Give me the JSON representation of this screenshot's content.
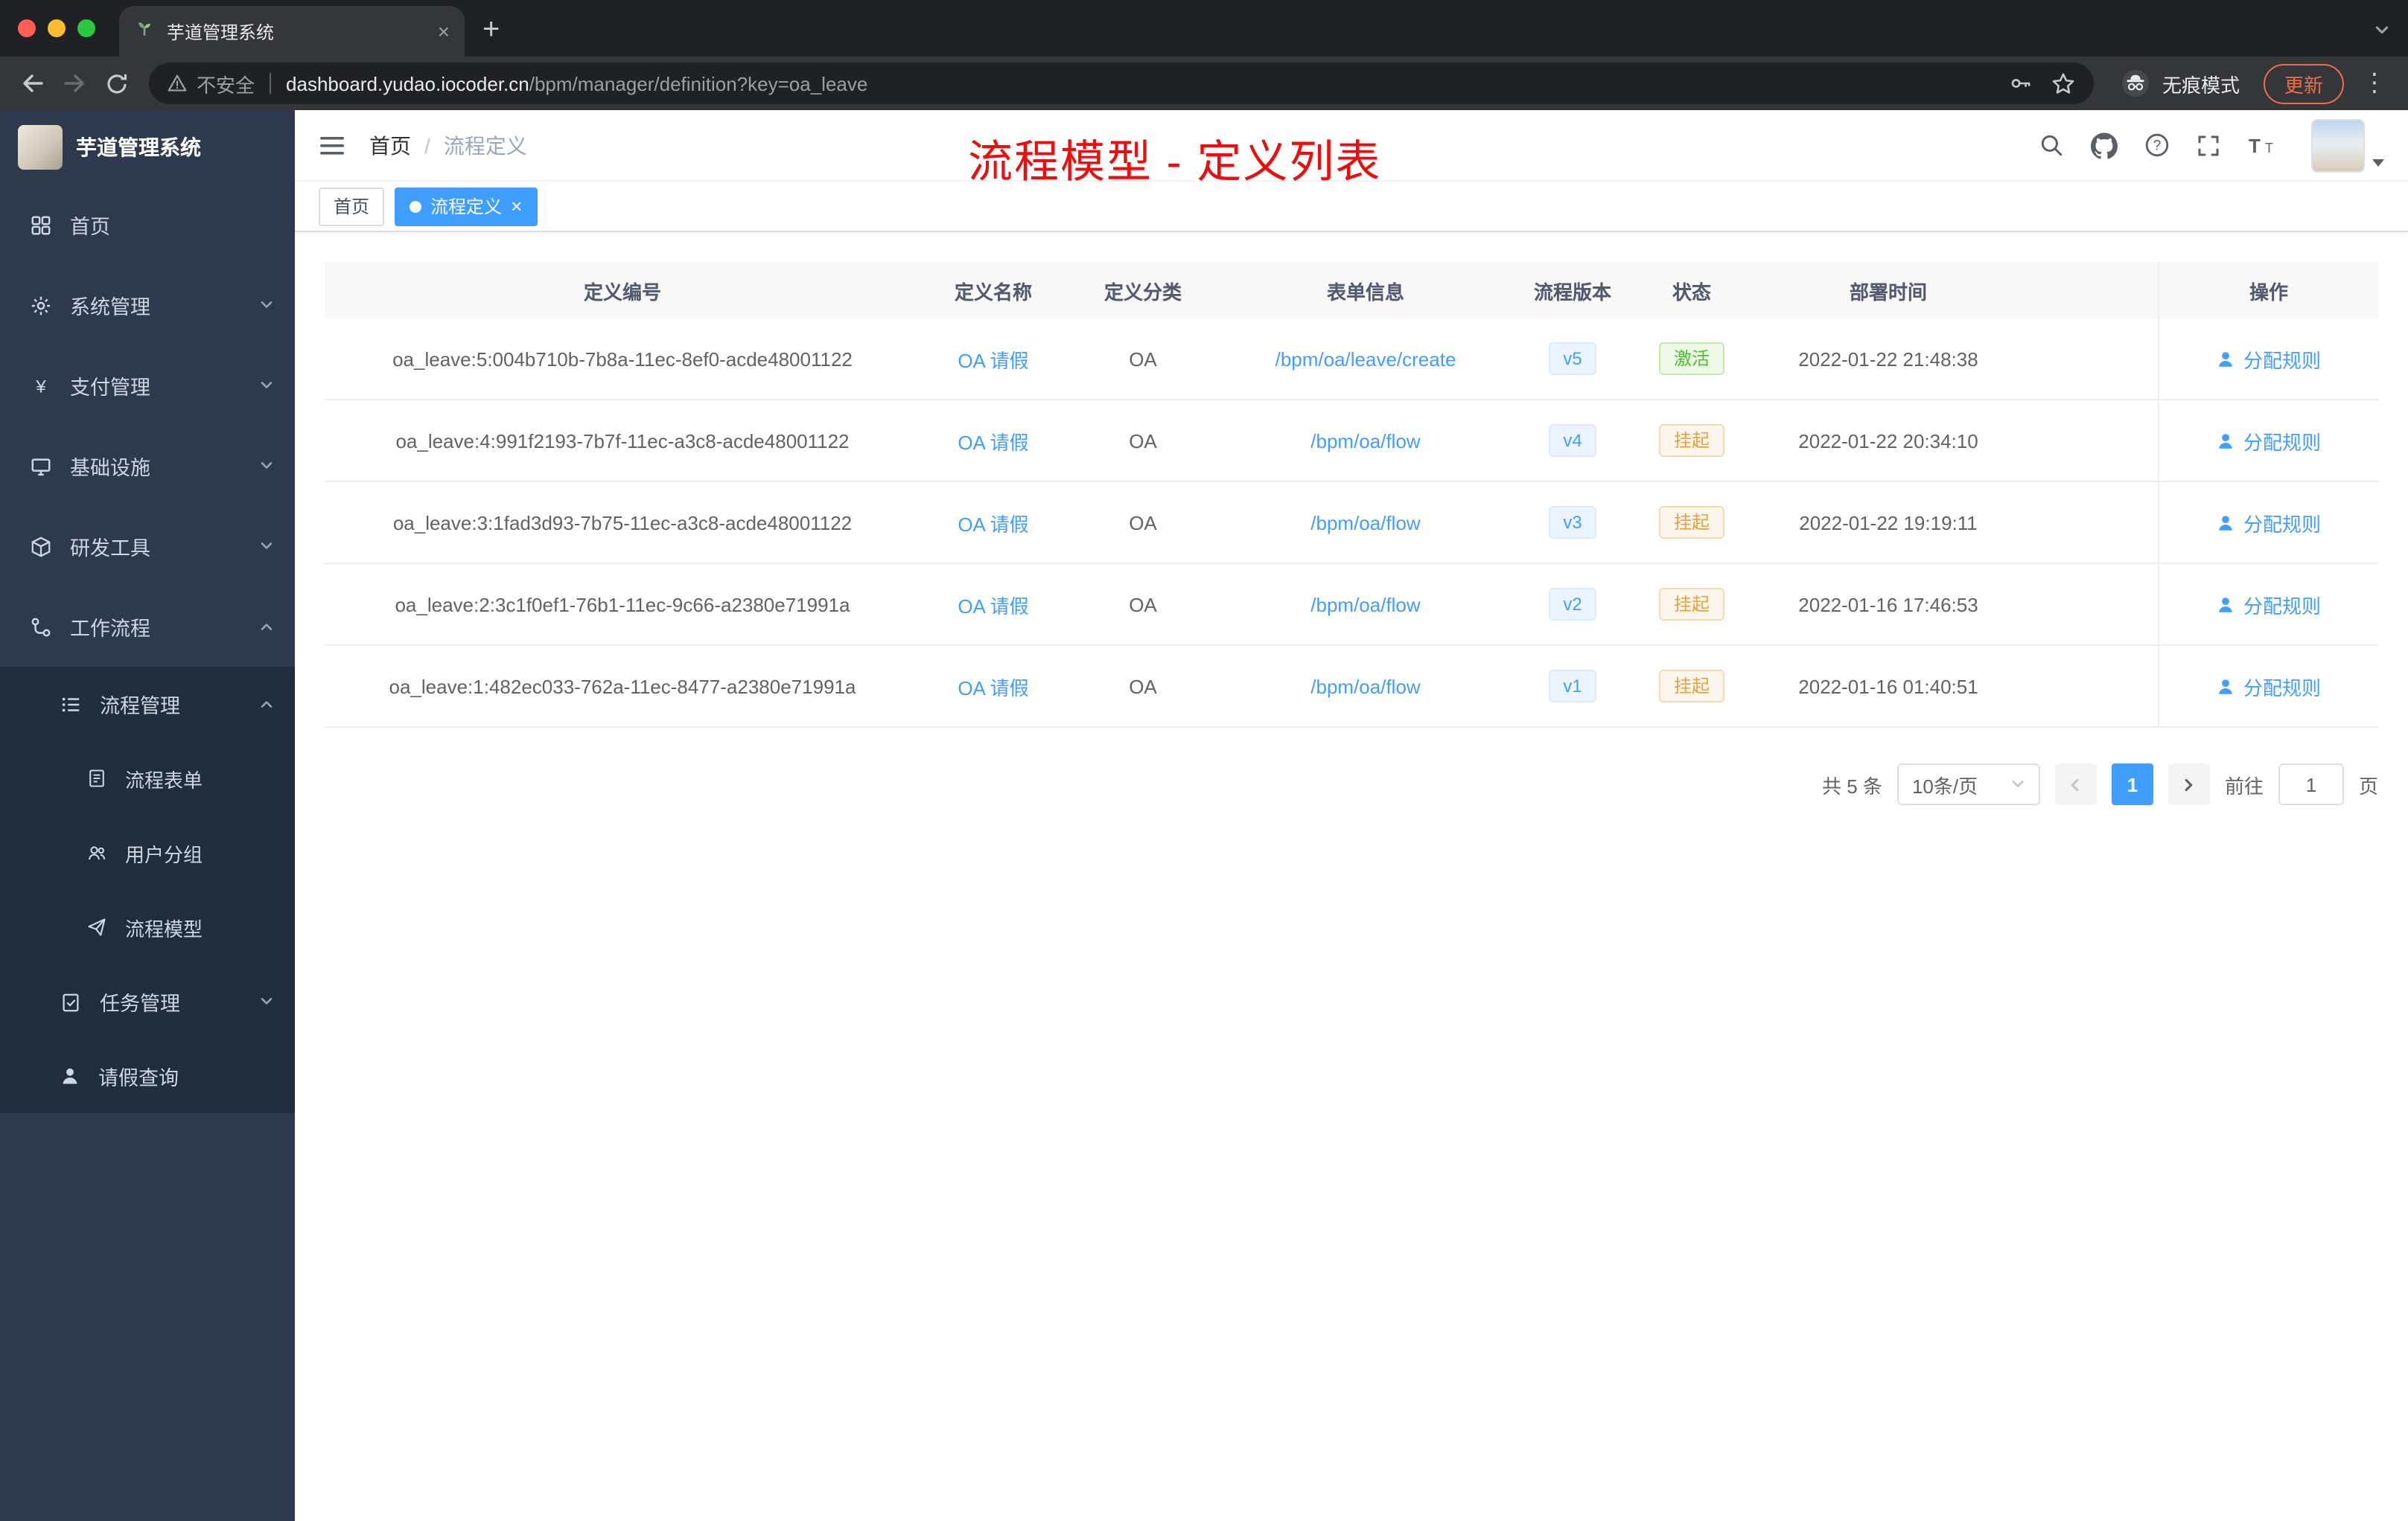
{
  "browser": {
    "tab_title": "芋道管理系统",
    "security_label": "不安全",
    "url_host": "dashboard.yudao.iocoder.cn",
    "url_path": "/bpm/manager/definition?key=oa_leave",
    "incognito_label": "无痕模式",
    "update_label": "更新"
  },
  "sidebar": {
    "logo_title": "芋道管理系统",
    "items": [
      {
        "label": "首页"
      },
      {
        "label": "系统管理"
      },
      {
        "label": "支付管理"
      },
      {
        "label": "基础设施"
      },
      {
        "label": "研发工具"
      },
      {
        "label": "工作流程"
      },
      {
        "label": "流程管理"
      },
      {
        "label": "流程表单"
      },
      {
        "label": "用户分组"
      },
      {
        "label": "流程模型"
      },
      {
        "label": "任务管理"
      },
      {
        "label": "请假查询"
      }
    ]
  },
  "header": {
    "breadcrumb_home": "首页",
    "breadcrumb_separator": "/",
    "breadcrumb_current": "流程定义",
    "annotation": "流程模型 - 定义列表"
  },
  "tags": {
    "home": "首页",
    "active": "流程定义"
  },
  "table": {
    "columns": [
      "定义编号",
      "定义名称",
      "定义分类",
      "表单信息",
      "流程版本",
      "状态",
      "部署时间",
      "操作"
    ],
    "rows": [
      {
        "id": "oa_leave:5:004b710b-7b8a-11ec-8ef0-acde48001122",
        "name": "OA 请假",
        "category": "OA",
        "form": "/bpm/oa/leave/create",
        "version": "v5",
        "status": "激活",
        "status_type": "success",
        "deploy_time": "2022-01-22 21:48:38",
        "action": "分配规则"
      },
      {
        "id": "oa_leave:4:991f2193-7b7f-11ec-a3c8-acde48001122",
        "name": "OA 请假",
        "category": "OA",
        "form": "/bpm/oa/flow",
        "version": "v4",
        "status": "挂起",
        "status_type": "warning",
        "deploy_time": "2022-01-22 20:34:10",
        "action": "分配规则"
      },
      {
        "id": "oa_leave:3:1fad3d93-7b75-11ec-a3c8-acde48001122",
        "name": "OA 请假",
        "category": "OA",
        "form": "/bpm/oa/flow",
        "version": "v3",
        "status": "挂起",
        "status_type": "warning",
        "deploy_time": "2022-01-22 19:19:11",
        "action": "分配规则"
      },
      {
        "id": "oa_leave:2:3c1f0ef1-76b1-11ec-9c66-a2380e71991a",
        "name": "OA 请假",
        "category": "OA",
        "form": "/bpm/oa/flow",
        "version": "v2",
        "status": "挂起",
        "status_type": "warning",
        "deploy_time": "2022-01-16 17:46:53",
        "action": "分配规则"
      },
      {
        "id": "oa_leave:1:482ec033-762a-11ec-8477-a2380e71991a",
        "name": "OA 请假",
        "category": "OA",
        "form": "/bpm/oa/flow",
        "version": "v1",
        "status": "挂起",
        "status_type": "warning",
        "deploy_time": "2022-01-16 01:40:51",
        "action": "分配规则"
      }
    ]
  },
  "pagination": {
    "total_label": "共 5 条",
    "page_size_label": "10条/页",
    "current_page": "1",
    "goto_label": "前往",
    "goto_value": "1",
    "page_unit_label": "页"
  },
  "colors": {
    "accent": "#409eff",
    "success_text": "#49c12a",
    "warning_text": "#e6a23c",
    "annotation_red": "#ed0d0d",
    "sidebar_bg": "#2d3a4e",
    "submenu_bg": "#1f2d3d"
  }
}
